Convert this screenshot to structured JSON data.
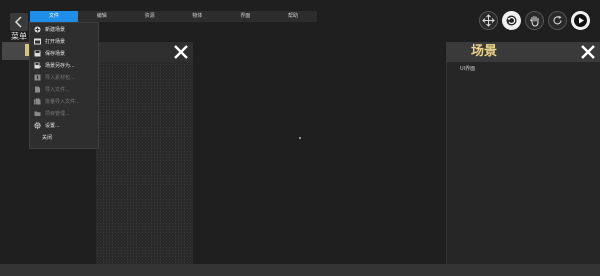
{
  "menubar": {
    "items": [
      "文件",
      "编辑",
      "资源",
      "物体",
      "界面",
      "帮助"
    ]
  },
  "menu_label": "菜单",
  "left_panel": {},
  "right_panel": {
    "title": "场景",
    "items": [
      "UI界面"
    ]
  },
  "file_menu": {
    "items": [
      {
        "label": "新建场景",
        "icon": "new-scene-icon",
        "enabled": true
      },
      {
        "label": "打开场景",
        "icon": "open-scene-icon",
        "enabled": true
      },
      {
        "label": "保存场景",
        "icon": "save-scene-icon",
        "enabled": true
      },
      {
        "label": "场景另存为...",
        "icon": "save-as-icon",
        "enabled": true
      },
      {
        "label": "导入素材包...",
        "icon": "import-package-icon",
        "enabled": false
      },
      {
        "label": "导入文件...",
        "icon": "import-file-icon",
        "enabled": false
      },
      {
        "label": "批量导入文件...",
        "icon": "batch-import-icon",
        "enabled": false
      },
      {
        "label": "项目管理...",
        "icon": "project-icon",
        "enabled": false
      },
      {
        "label": "设置...",
        "icon": "settings-icon",
        "enabled": true
      },
      {
        "label": "关闭",
        "icon": "",
        "enabled": true
      }
    ]
  },
  "colors": {
    "accent": "#1f8ee8",
    "scene_title": "#e8d28a"
  }
}
